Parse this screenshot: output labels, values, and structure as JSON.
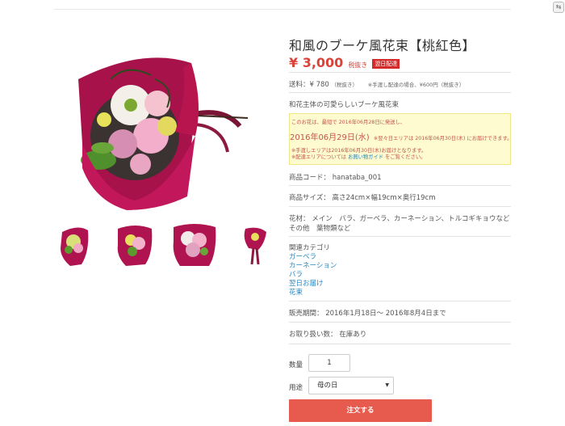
{
  "product": {
    "title": "和風のブーケ風花束【桃紅色】",
    "price": "¥ 3,000",
    "tax_note": "税抜き",
    "badge": "翌日配達",
    "shipping": "送料：¥ 780",
    "shipping_tax": "（税抜き）",
    "shipping_note": "※手渡し配達の場合、¥600円（税抜き）",
    "description": "和花主体の可愛らしいブーケ風花束"
  },
  "notice": {
    "line1": "このお花は、最短で 2016年06月28日に発送し、",
    "date_big": "2016年06月29日(水)",
    "line2_pre": "※翌々日エリアは",
    "line2_hl": "2016年06月30日(木)",
    "line2_post": "にお届けできます。",
    "line3": "※手渡しエリアは2016年06月30日(木)お届けとなります。",
    "line4_pre": "※配達エリアについては",
    "line4_link": "お買い物ガイド",
    "line4_post": "をご覧ください。"
  },
  "details": {
    "code": "商品コード： hanataba_001",
    "size": "商品サイズ： 高さ24cm×幅19cm×奥行19cm",
    "material_1": "花材： メイン　バラ、ガーベラ、カーネーション、トルコギキョウなど",
    "material_2": "その他　葉物類など",
    "category_heading": "関連カテゴリ",
    "categories": [
      "ガーベラ",
      "カーネーション",
      "バラ",
      "翌日お届け",
      "花束"
    ],
    "period": "販売期間： 2016年1月18日～ 2016年8月4日まで",
    "handling": "お取り扱い数： 在庫あり"
  },
  "order": {
    "qty_label": "数量",
    "qty_value": "1",
    "use_label": "用途",
    "use_value": "母の日",
    "order_button": "注文する"
  },
  "colors": {
    "accent": "#e75a4e",
    "price": "#d9433a",
    "link": "#2a87c2",
    "wrap": "#c2185b",
    "notice_bg": "#fdfbcf"
  }
}
